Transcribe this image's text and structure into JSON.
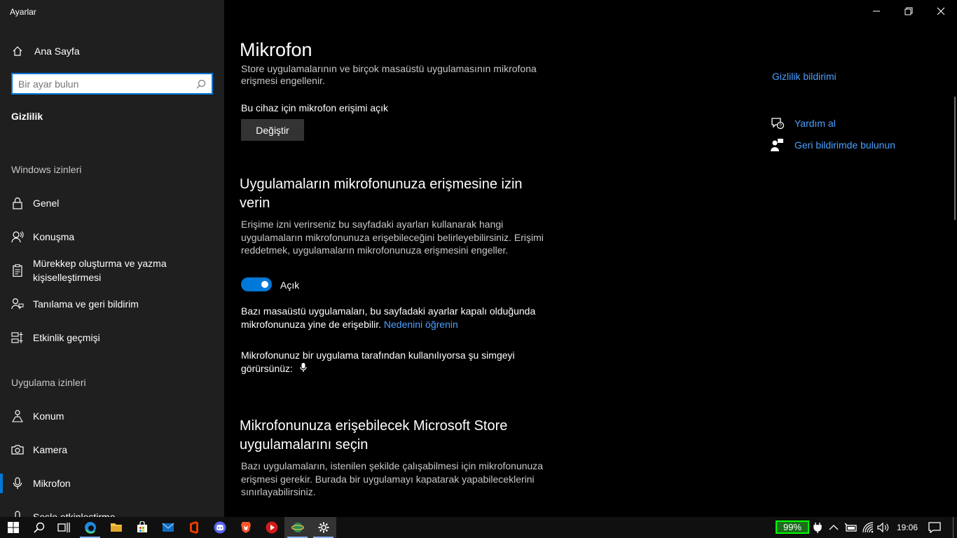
{
  "window": {
    "title": "Ayarlar"
  },
  "sidebar": {
    "home_label": "Ana Sayfa",
    "search_placeholder": "Bir ayar bulun",
    "current_section": "Gizlilik",
    "windows_permissions_label": "Windows izinleri",
    "windows_items": [
      {
        "label": "Genel",
        "icon": "lock-icon"
      },
      {
        "label": "Konuşma",
        "icon": "speech-icon"
      },
      {
        "label": "Mürekkep oluşturma ve yazma kişiselleştirmesi",
        "icon": "clipboard-icon"
      },
      {
        "label": "Tanılama ve geri bildirim",
        "icon": "feedback-icon"
      },
      {
        "label": "Etkinlik geçmişi",
        "icon": "timeline-icon"
      }
    ],
    "app_permissions_label": "Uygulama izinleri",
    "app_items": [
      {
        "label": "Konum",
        "icon": "location-icon"
      },
      {
        "label": "Kamera",
        "icon": "camera-icon"
      },
      {
        "label": "Mikrofon",
        "icon": "microphone-icon",
        "active": true
      },
      {
        "label": "Sesle etkinleştirme",
        "icon": "voice-icon"
      }
    ]
  },
  "main": {
    "page_title": "Mikrofon",
    "intro_text_line1": "Store uygulamalarının ve birçok masaüstü uygulamasının mikrofona",
    "intro_text_line2": "erişmesi engellenir.",
    "device_status": "Bu cihaz için mikrofon erişimi açık",
    "change_button": "Değiştir",
    "allow_heading": "Uygulamaların mikrofonunuza erişmesine izin verin",
    "allow_desc": "Erişime izni verirseniz bu sayfadaki ayarları kullanarak hangi uygulamaların mikrofonunuza erişebileceğini belirleyebilirsiniz. Erişimi reddetmek, uygulamaların mikrofonunuza erişmesini engeller.",
    "toggle_label": "Açık",
    "desktop_note": "Bazı masaüstü uygulamaları, bu sayfadaki ayarlar kapalı olduğunda mikrofonunuza yine de erişebilir.",
    "learn_why_link": "Nedenini öğrenin",
    "icon_note": "Mikrofonunuz bir uygulama tarafından kullanılıyorsa şu simgeyi görürsünüz:",
    "store_heading": "Mikrofonunuza erişebilecek Microsoft Store uygulamalarını seçin",
    "store_desc": "Bazı uygulamaların, istenilen şekilde çalışabilmesi için mikrofonunuza erişmesi gerekir. Burada bir uygulamayı kapatarak yapabileceklerini sınırlayabilirsiniz."
  },
  "side_panel": {
    "privacy_statement": "Gizlilik bildirimi",
    "get_help": "Yardım al",
    "give_feedback": "Geri bildirimde bulunun"
  },
  "taskbar": {
    "battery": "99%",
    "time": "19:06",
    "accent": "#0078d7"
  }
}
